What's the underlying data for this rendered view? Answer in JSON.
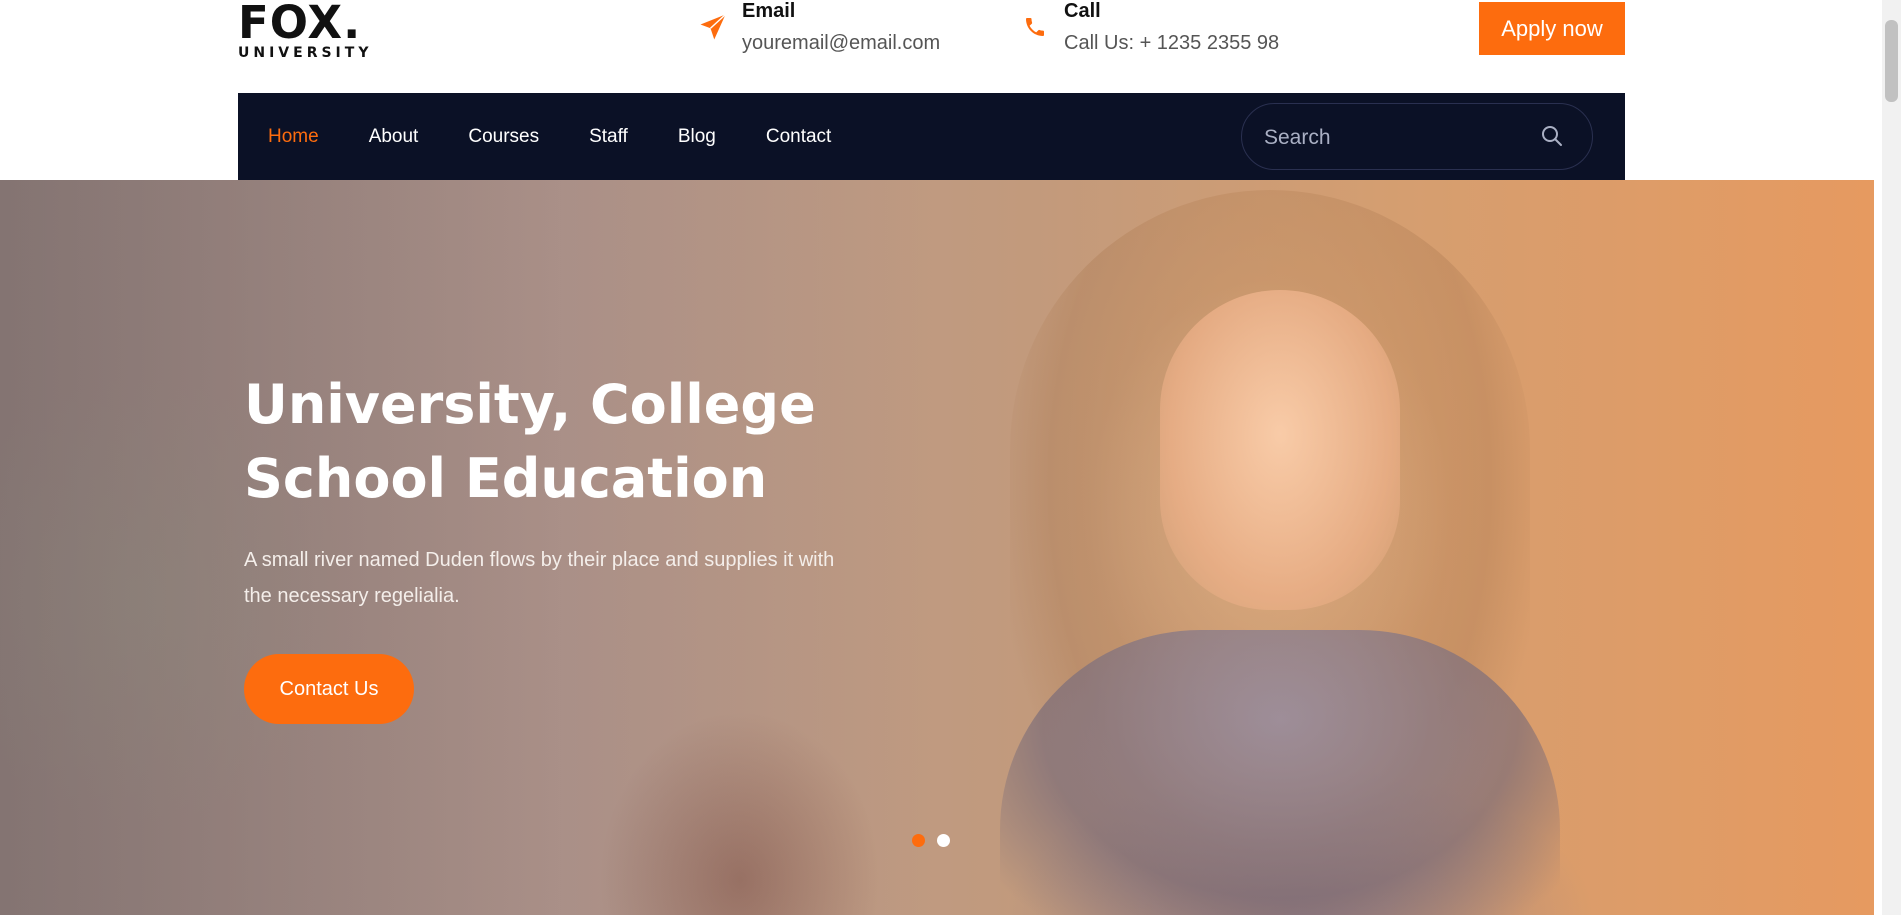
{
  "brand": {
    "name": "FOX.",
    "subtitle": "UNIVERSITY"
  },
  "header": {
    "email": {
      "title": "Email",
      "value": "youremail@email.com",
      "icon": "paper-plane-icon"
    },
    "call": {
      "title": "Call",
      "value": "Call Us: + 1235 2355 98",
      "icon": "phone-icon"
    },
    "apply_label": "Apply now"
  },
  "nav": {
    "items": [
      {
        "label": "Home",
        "active": true
      },
      {
        "label": "About"
      },
      {
        "label": "Courses"
      },
      {
        "label": "Staff"
      },
      {
        "label": "Blog"
      },
      {
        "label": "Contact"
      }
    ],
    "search_placeholder": "Search"
  },
  "hero": {
    "title_line1": "University, College",
    "title_line2": "School Education",
    "text_line1": "A small river named Duden flows by their place and supplies it with",
    "text_line2": "the necessary regelialia.",
    "button_label": "Contact Us",
    "slides": 2,
    "active_slide": 1
  },
  "colors": {
    "accent": "#fd6c0e",
    "nav_bg": "#0b1126"
  }
}
